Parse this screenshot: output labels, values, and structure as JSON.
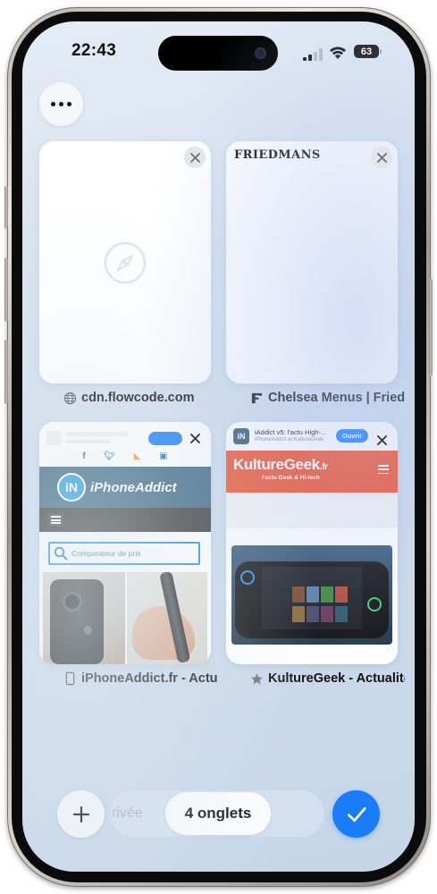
{
  "status_bar": {
    "time": "22:43",
    "battery_level": "63"
  },
  "toolbar": {
    "more_icon": "ellipsis-icon"
  },
  "tabs": [
    {
      "title": "cdn.flowcode.com",
      "favicon": "globe-icon",
      "content": "blank-page-compass"
    },
    {
      "title": "Chelsea Menus | Fried...",
      "favicon": "friedmans-f-icon",
      "content": "friedmans",
      "logo_text": "FRIEDMANS"
    },
    {
      "title": "iPhoneAddict.fr - Actu...",
      "favicon": "iphone-outline-icon",
      "content": "iphoneaddict",
      "logo_text": "iPhoneAddict",
      "search_placeholder": "Comparateur de prix"
    },
    {
      "title": "KultureGeek - Actualité...",
      "favicon": "star-icon",
      "content": "kulturegeek",
      "app_banner_title": "iAddict v5: l'actu High-...",
      "app_banner_subtitle": "iPhoneAddict et KultureGeek",
      "open_button": "Ouvrir",
      "logo_text": "KultureGeek",
      "logo_suffix": ".fr",
      "tagline": "l'actu Geek & Hi-tech"
    }
  ],
  "bottom_bar": {
    "private_label": "rivée",
    "tabs_count_label": "4 onglets",
    "add_icon": "plus-icon",
    "done_icon": "checkmark-icon"
  },
  "colors": {
    "accent_blue": "#1a7df5",
    "kulturegeek_orange": "#f0522e",
    "iphoneaddict_header": "#3c6680"
  }
}
